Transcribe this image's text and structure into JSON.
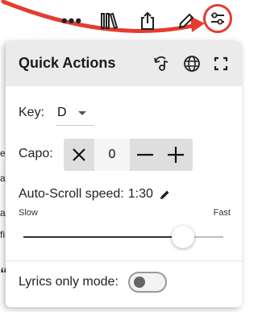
{
  "toolbar": {
    "items": [
      {
        "icon": "more-horizontal-icon",
        "glyph": "•••"
      },
      {
        "icon": "library-icon"
      },
      {
        "icon": "share-icon"
      },
      {
        "icon": "pencil-icon"
      },
      {
        "icon": "settings-sliders-icon",
        "highlighted": true
      }
    ],
    "highlight_color": "#e63b30"
  },
  "background_text": [
    "e",
    "as",
    "a",
    "fi",
    "“"
  ],
  "panel": {
    "title": "Quick Actions",
    "header_icons": [
      "transpose-icon",
      "globe-icon",
      "fullscreen-icon"
    ],
    "key": {
      "label": "Key:",
      "value": "D"
    },
    "capo": {
      "label": "Capo:",
      "value": "0",
      "reset_glyph": "✕",
      "minus_glyph": "−",
      "plus_glyph": "+"
    },
    "autoscroll": {
      "label": "Auto-Scroll speed:",
      "value": "1:30",
      "slow_label": "Slow",
      "fast_label": "Fast",
      "level": 0.8
    },
    "lyrics_only": {
      "label": "Lyrics only mode:",
      "enabled": false
    }
  }
}
